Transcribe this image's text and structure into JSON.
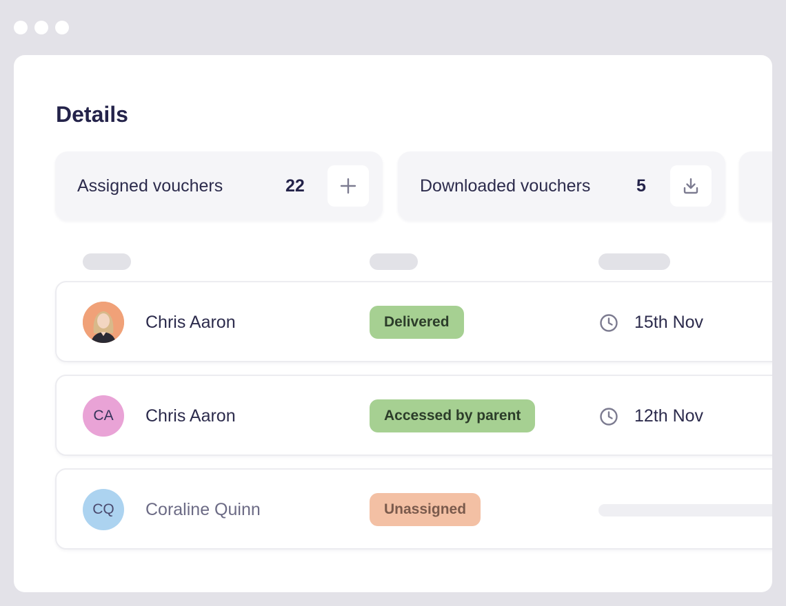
{
  "page": {
    "title": "Details"
  },
  "stats": [
    {
      "label": "Assigned vouchers",
      "value": "22",
      "action_icon": "plus-icon"
    },
    {
      "label": "Downloaded vouchers",
      "value": "5",
      "action_icon": "download-icon"
    }
  ],
  "rows": [
    {
      "name": "Chris Aaron",
      "avatar": {
        "type": "photo",
        "bg": "#f0a178"
      },
      "status": {
        "label": "Delivered",
        "bg": "#a6d092",
        "fg": "#2c3d2a"
      },
      "date": "15th Nov",
      "date_icon": "clock-icon"
    },
    {
      "name": "Chris Aaron",
      "avatar": {
        "type": "initials",
        "initials": "CA",
        "bg": "#e9a3d6"
      },
      "status": {
        "label": "Accessed by parent",
        "bg": "#a6d092",
        "fg": "#2c3d2a"
      },
      "date": "12th Nov",
      "date_icon": "clock-icon"
    },
    {
      "name": "Coraline Quinn",
      "avatar": {
        "type": "initials",
        "initials": "CQ",
        "bg": "#acd3f0"
      },
      "status": {
        "label": "Unassigned",
        "bg": "#f3c0a4",
        "fg": "#7a5a4c"
      },
      "date": "",
      "date_icon": ""
    }
  ],
  "colors": {
    "frame": "#e3e2e8",
    "panel": "#ffffff",
    "title": "#24234a",
    "card": "#f5f5f8",
    "success": "#a6d092",
    "warning": "#f3c0a4"
  }
}
